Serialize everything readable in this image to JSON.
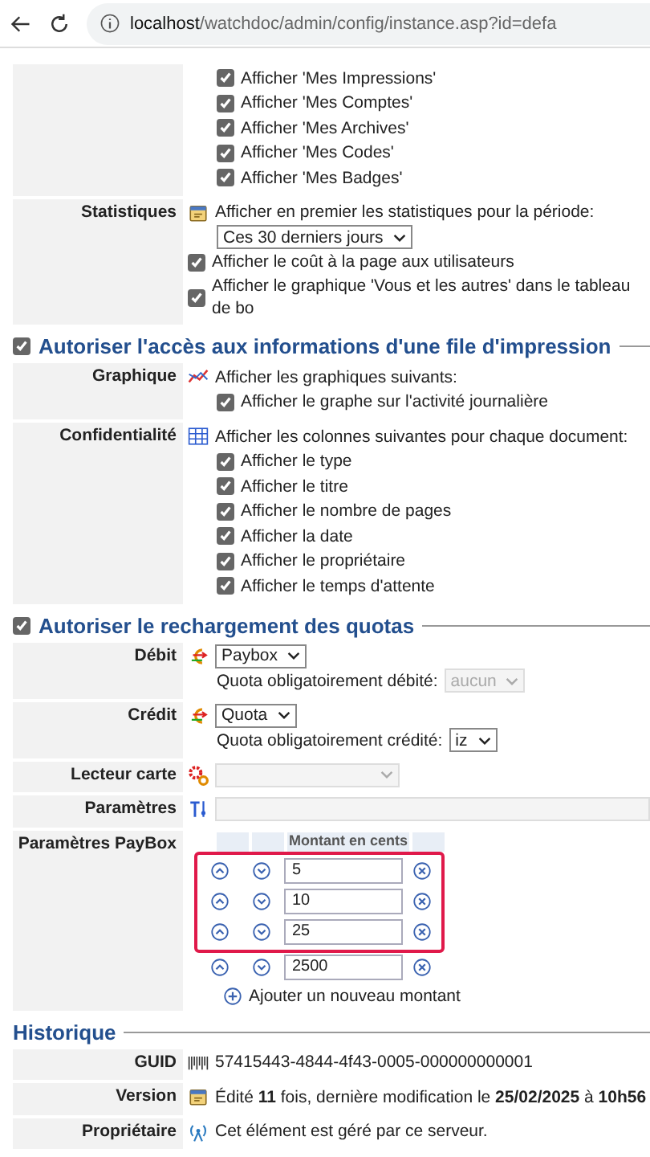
{
  "address_bar": {
    "host": "localhost",
    "path": "/watchdoc/admin/config/instance.asp?id=defa"
  },
  "sections": [
    {
      "rows": [
        {
          "items": [
            {
              "kind": "list",
              "children": [
                {
                  "kind": "check",
                  "text": "Afficher 'Mes Impressions'",
                  "checked": true
                },
                {
                  "kind": "check",
                  "text": "Afficher 'Mes Comptes'",
                  "checked": true
                },
                {
                  "kind": "check",
                  "text": "Afficher 'Mes Archives'",
                  "checked": true
                },
                {
                  "kind": "check",
                  "text": "Afficher 'Mes Codes'",
                  "checked": true
                },
                {
                  "kind": "check",
                  "text": "Afficher 'Mes Badges'",
                  "checked": true
                }
              ]
            }
          ]
        },
        {
          "label": "Statistiques",
          "items": [
            {
              "kind": "text",
              "text": "Afficher en premier les statistiques pour la période:",
              "children": [
                {
                  "kind": "select",
                  "value": "Ces 30 derniers jours",
                  "disabled": false
                }
              ]
            },
            {
              "kind": "check",
              "text": "Afficher le coût à la page aux utilisateurs",
              "checked": true
            },
            {
              "kind": "check",
              "text": "Afficher le graphique 'Vous et les autres' dans le tableau de bo",
              "checked": true
            }
          ]
        }
      ]
    },
    {
      "title": "Autoriser l'accès aux informations d'une file d'impression",
      "checked": true,
      "rows": [
        {
          "label": "Graphique",
          "items": [
            {
              "kind": "text",
              "text": "Afficher les graphiques suivants:",
              "children": [
                {
                  "kind": "check",
                  "text": "Afficher le graphe sur l'activité journalière",
                  "checked": true
                }
              ]
            }
          ]
        },
        {
          "label": "Confidentialité",
          "items": [
            {
              "kind": "text",
              "text": "Afficher les colonnes suivantes pour chaque document:",
              "children": [
                {
                  "kind": "check",
                  "text": "Afficher le type",
                  "checked": true
                },
                {
                  "kind": "check",
                  "text": "Afficher le titre",
                  "checked": true
                },
                {
                  "kind": "check",
                  "text": "Afficher le nombre de pages",
                  "checked": true
                },
                {
                  "kind": "check",
                  "text": "Afficher la date",
                  "checked": true
                },
                {
                  "kind": "check",
                  "text": "Afficher le propriétaire",
                  "checked": true
                },
                {
                  "kind": "check",
                  "text": "Afficher le temps d'attente",
                  "checked": true
                }
              ]
            }
          ]
        }
      ]
    },
    {
      "title": "Autoriser le rechargement des quotas",
      "checked": true,
      "rows": [
        {
          "label": "Débit",
          "items": [
            {
              "kind": "select",
              "value": "Paybox",
              "disabled": false,
              "children": [
                {
                  "kind": "select",
                  "caption": "Quota obligatoirement débité:",
                  "value": "aucun",
                  "disabled": true
                }
              ]
            }
          ]
        },
        {
          "label": "Crédit",
          "items": [
            {
              "kind": "select",
              "value": "Quota",
              "disabled": false,
              "children": [
                {
                  "kind": "select",
                  "caption": "Quota obligatoirement crédité:",
                  "value": "iz",
                  "disabled": false
                }
              ]
            }
          ]
        },
        {
          "label": "Lecteur carte",
          "items": [
            {
              "kind": "select",
              "disabled": true
            }
          ]
        },
        {
          "label": "Paramètres",
          "items": [
            {
              "kind": "field",
              "disabled": true
            }
          ]
        },
        {
          "label": "Paramètres PayBox",
          "items": [
            {
              "kind": "amounts",
              "header": "Montant en cents",
              "add": "Ajouter un nouveau montant",
              "rows": [
                {
                  "value": "5",
                  "highlighted": true
                },
                {
                  "value": "10",
                  "highlighted": true
                },
                {
                  "value": "25",
                  "highlighted": true
                },
                {
                  "value": "2500",
                  "highlighted": false
                }
              ]
            }
          ]
        }
      ]
    },
    {
      "title": "Historique",
      "rows": [
        {
          "label": "GUID",
          "items": [
            {
              "kind": "text",
              "text": "57415443-4844-4f43-0005-000000000001"
            }
          ]
        },
        {
          "label": "Version",
          "items": [
            {
              "kind": "text",
              "text": "Édité **11** fois, dernière modification le **25/02/2025** à **10h56**"
            }
          ]
        },
        {
          "label": "Propriétaire",
          "items": [
            {
              "kind": "text",
              "text": "Cet élément est géré par ce serveur."
            }
          ]
        }
      ]
    }
  ]
}
